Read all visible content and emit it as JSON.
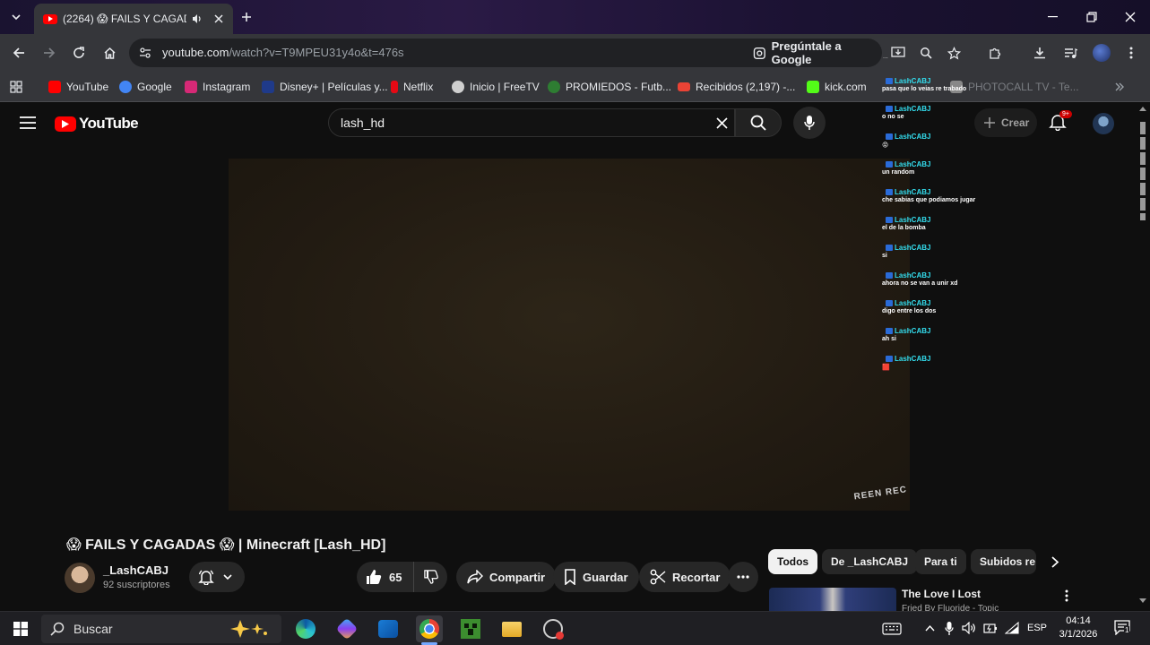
{
  "browser": {
    "tab": {
      "title": "(2264) 😱 FAILS Y CAGADAS 😱 | Minecraft [Lash_HD]",
      "title_visible": "(2264) 😱 FAILS Y CAGADA"
    },
    "url": {
      "host": "youtube.com",
      "path": "/watch?v=T9MPEU31y4o&t=476s"
    },
    "ask_google": "Pregúntale a Google",
    "bookmarks": [
      {
        "label": "YouTube",
        "color": "#ff0000"
      },
      {
        "label": "Google",
        "color": "#4285f4"
      },
      {
        "label": "Instagram",
        "color": "#d62976"
      },
      {
        "label": "Disney+ | Películas y...",
        "color": "#1f3a8a"
      },
      {
        "label": "Netflix",
        "color": "#e50914"
      },
      {
        "label": "Inicio | FreeTV",
        "color": "#cfcfcf"
      },
      {
        "label": "PROMIEDOS - Futb...",
        "color": "#2e7d32"
      },
      {
        "label": "Recibidos (2,197) -...",
        "color": "#ea4335"
      },
      {
        "label": "kick.com",
        "color": "#53fc18"
      },
      {
        "label": "PHOTOCALL TV - Te...",
        "color": "#888888"
      }
    ]
  },
  "youtube": {
    "logo_text": "YouTube",
    "search_value": "lash_hd",
    "create_label": "Crear",
    "notif_badge": "9+"
  },
  "chat": {
    "top_fragment": "...",
    "messages": [
      {
        "user": "LashCABJ",
        "text": "pasa que lo veias re trabado"
      },
      {
        "user": "LashCABJ",
        "text": "o no se"
      },
      {
        "user": "LashCABJ",
        "text": "😡"
      },
      {
        "user": "LashCABJ",
        "text": "un random"
      },
      {
        "user": "LashCABJ",
        "text": "che sabias que podiamos jugar"
      },
      {
        "user": "LashCABJ",
        "text": "el de la bomba"
      },
      {
        "user": "LashCABJ",
        "text": "si"
      },
      {
        "user": "LashCABJ",
        "text": "ahora no se van a unir xd"
      },
      {
        "user": "LashCABJ",
        "text": "digo entre los dos"
      },
      {
        "user": "LashCABJ",
        "text": "ah si"
      },
      {
        "user": "LashCABJ",
        "text": "🟥"
      }
    ]
  },
  "video": {
    "watermark": "REEN REC",
    "title": "😱 FAILS Y CAGADAS 😱 | Minecraft [Lash_HD]",
    "channel": "_LashCABJ",
    "subscribers": "92 suscriptores",
    "likes": "65",
    "share_label": "Compartir",
    "save_label": "Guardar",
    "clip_label": "Recortar"
  },
  "chips": [
    "Todos",
    "De _LashCABJ",
    "Para ti",
    "Subidos re"
  ],
  "recommended": {
    "title": "The Love I Lost",
    "subtitle": "Fried By Fluoride - Topic"
  },
  "taskbar": {
    "search_placeholder": "Buscar",
    "lang": "ESP",
    "time": "04:14",
    "date": "3/1/2026",
    "notif_count": "1"
  }
}
